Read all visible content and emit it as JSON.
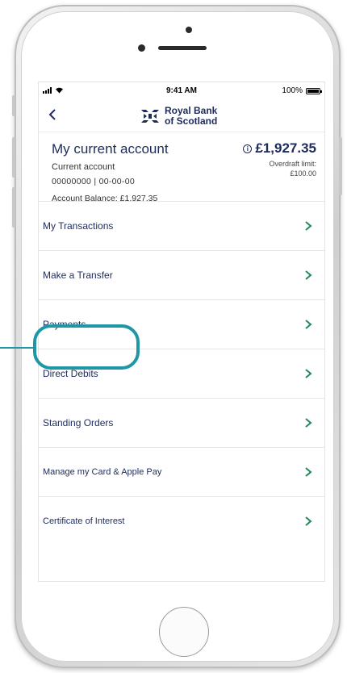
{
  "status_bar": {
    "time": "9:41 AM",
    "battery": "100%",
    "battery_level": 1.0
  },
  "nav": {
    "back_label": "<",
    "brand_line1": "Royal Bank",
    "brand_line2": "of Scotland"
  },
  "account": {
    "title": "My current account",
    "type": "Current account",
    "number": "00000000 | 00-00-00",
    "balance_text": "Account Balance: £1,927.35",
    "balance_amount": "£1,927.35",
    "overdraft_line1": "Overdraft limit:",
    "overdraft_line2": "£100.00"
  },
  "menu": {
    "items": [
      {
        "label": "My Transactions"
      },
      {
        "label": "Make a Transfer"
      },
      {
        "label": "Payments"
      },
      {
        "label": "Direct Debits"
      },
      {
        "label": "Standing Orders"
      },
      {
        "label": "Manage my Card & Apple Pay"
      },
      {
        "label": "Certificate of Interest"
      }
    ]
  },
  "colors": {
    "brand_navy": "#1d2b5c",
    "highlight_teal": "#1e96a6",
    "chevron_green": "#1f8a5b"
  },
  "icons": [
    "signal-icon",
    "wifi-icon",
    "battery-icon",
    "back-chevron-icon",
    "rbs-logo-icon",
    "info-icon",
    "chevron-right-icon"
  ]
}
